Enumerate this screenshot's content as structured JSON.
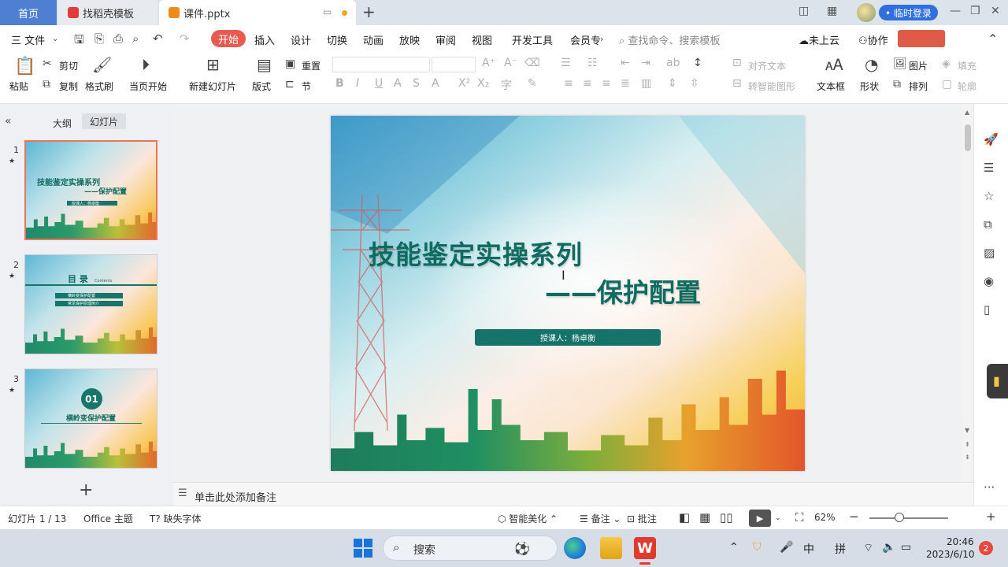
{
  "tabs": {
    "home": "首页",
    "template": "找稻壳模板",
    "file": "课件.pptx",
    "add": "+"
  },
  "titlebar": {
    "login": "• 临时登录"
  },
  "menu": {
    "file": "三 文件",
    "items": [
      "开始",
      "插入",
      "设计",
      "切换",
      "动画",
      "放映",
      "审阅",
      "视图",
      "开发工具",
      "会员专"
    ],
    "search": "查找命令、搜索模板",
    "upload": "未上云",
    "collab": "协作"
  },
  "ribbon": {
    "paste": "粘贴",
    "cut": "剪切",
    "copy": "复制",
    "format_painter": "格式刷",
    "from_current": "当页开始",
    "new_slide": "新建幻灯片",
    "layout": "版式",
    "reset": "重置",
    "section": "节",
    "align_text": "对齐文本",
    "smart_shape": "转智能图形",
    "textbox": "文本框",
    "shape": "形状",
    "picture": "图片",
    "arrange": "排列",
    "fill": "填充",
    "outline": "轮廓"
  },
  "left_panel": {
    "outline": "大纲",
    "slides": "幻灯片",
    "thumbs": [
      {
        "num": "1",
        "title": "技能鉴定实操系列",
        "subtitle": "——保护配置",
        "bar": "授课人：杨卓衡"
      },
      {
        "num": "2",
        "title": "目 录",
        "contents": "Contents",
        "item1": "横岭变保护配置",
        "item2": "常见保护原理简介"
      },
      {
        "num": "3",
        "badge": "01",
        "title": "横岭变保护配置"
      }
    ],
    "add": "+"
  },
  "slide": {
    "title": "技能鉴定实操系列",
    "subtitle": "——保护配置",
    "lecturer": "授课人：杨卓衡"
  },
  "notes": {
    "placeholder": "单击此处添加备注"
  },
  "status": {
    "slide_count": "幻灯片 1 / 13",
    "theme": "Office 主题",
    "missing_font": "缺失字体",
    "beautify": "智能美化",
    "notes": "备注",
    "comments": "批注",
    "zoom": "62%"
  },
  "taskbar": {
    "search": "搜索",
    "ime1": "中",
    "ime2": "拼",
    "time": "20:46",
    "date": "2023/6/10",
    "notifications": "2"
  },
  "colors": {
    "accent_red": "#e85a4f",
    "slide_green": "#0d6b5f",
    "tab_blue": "#4f7fd1"
  }
}
